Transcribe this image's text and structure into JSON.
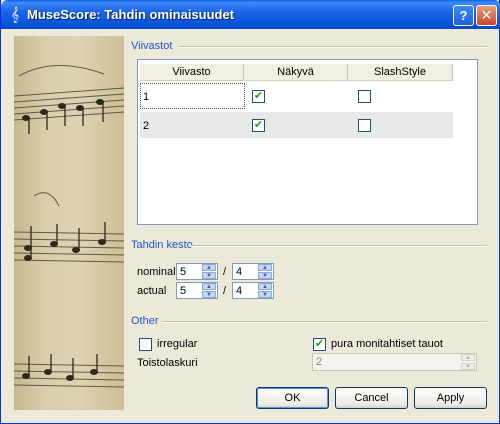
{
  "window": {
    "title": "MuseScore: Tahdin ominaisuudet",
    "help_glyph": "?",
    "close_glyph": "✕"
  },
  "staves": {
    "section_title": "Viivastot",
    "headers": [
      "Viivasto",
      "Näkyvä",
      "SlashStyle"
    ],
    "rows": [
      {
        "staff": "1",
        "visible": true,
        "slash": false
      },
      {
        "staff": "2",
        "visible": true,
        "slash": false
      }
    ]
  },
  "duration": {
    "section_title": "Tahdin kesto",
    "nominal_label": "nominal",
    "nominal_num": "5",
    "nominal_den": "4",
    "actual_label": "actual",
    "actual_num": "5",
    "actual_den": "4",
    "separator": "/"
  },
  "other": {
    "section_title": "Other",
    "irregular_label": "irregular",
    "irregular_checked": false,
    "break_rests_label": "pura monitahtiset tauot",
    "break_rests_checked": true,
    "repeat_label": "Toistolaskuri",
    "repeat_value": "2"
  },
  "buttons": {
    "ok": "OK",
    "cancel": "Cancel",
    "apply": "Apply"
  },
  "icons": {
    "check": "✔",
    "spin_up": "▲",
    "spin_down": "▼",
    "app": "𝄞"
  },
  "colors": {
    "title_bar": "#0553d8",
    "section_title": "#2255cc",
    "check": "#21a121"
  }
}
